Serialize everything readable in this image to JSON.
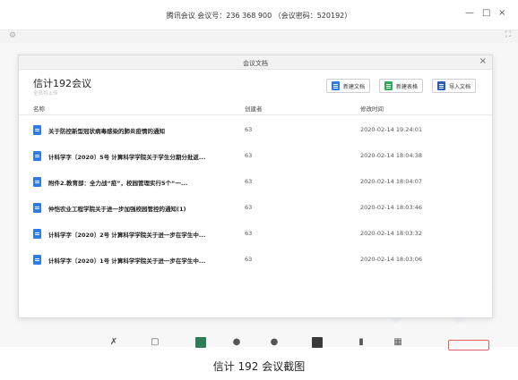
{
  "window": {
    "title": "腾讯会议 会议号：236 368 900 （会议密码：520192）",
    "min_icon": "—",
    "max_icon": "□",
    "close_icon": "×",
    "settings_icon": "⚙",
    "fullscreen_icon": "⛶"
  },
  "dialog": {
    "title": "会议文档",
    "close_icon": "×",
    "meeting_name": "信计192会议",
    "subtitle": "全员可上传",
    "buttons": {
      "new_doc": "新建文档",
      "new_sheet": "新建表格",
      "import_doc": "导入文档"
    },
    "columns": {
      "name": "名称",
      "creator": "创建者",
      "modified": "修改时间"
    },
    "rows": [
      {
        "name": "关于防控新型冠状病毒感染的肺炎疫情的通知",
        "creator": "63",
        "modified": "2020-02-14 19:24:01"
      },
      {
        "name": "计科学字〔2020〕5号 计算科学学院关于学生分期分批返...",
        "creator": "63",
        "modified": "2020-02-14 18:04:38"
      },
      {
        "name": "附件2.教育部：全力战“疫”，校园管理实行5个“一...",
        "creator": "63",
        "modified": "2020-02-14 18:04:07"
      },
      {
        "name": "仲恺农业工程学院关于进一步加强校园管控的通知(1)",
        "creator": "63",
        "modified": "2020-02-14 18:03:46"
      },
      {
        "name": "计科学字〔2020〕2号 计算科学学院关于进一步在学生中...",
        "creator": "63",
        "modified": "2020-02-14 18:03:32"
      },
      {
        "name": "计科学字〔2020〕1号 计算科学学院关于进一步在学生中...",
        "creator": "63",
        "modified": "2020-02-14 18:03:06"
      }
    ]
  },
  "caption": "信计 192 会议截图",
  "colors": {
    "doc_blue": "#2d7be5",
    "sheet_green": "#2eab55",
    "leave_red": "#e06060"
  }
}
